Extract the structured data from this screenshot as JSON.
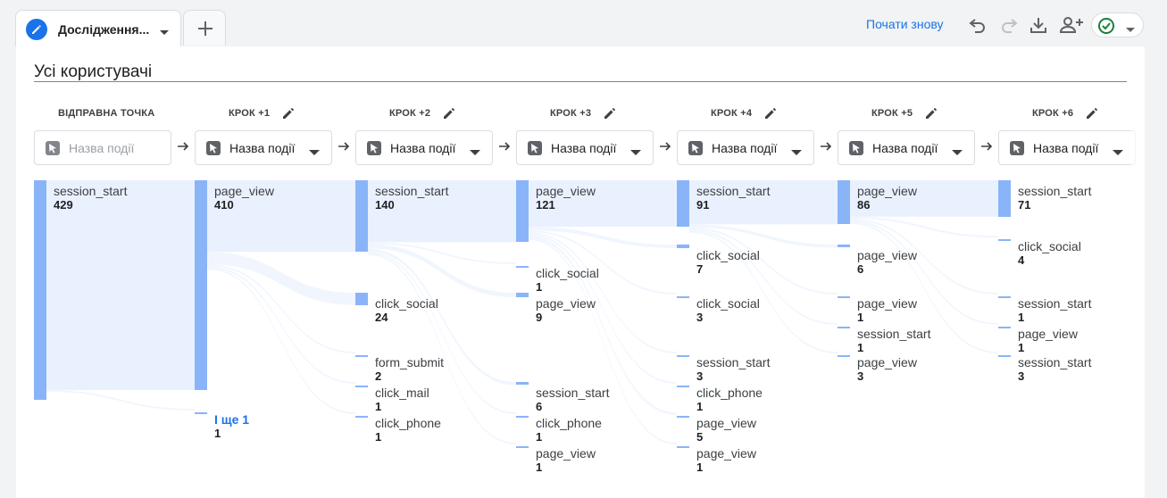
{
  "tab": {
    "title": "Дослідження..."
  },
  "toolbar": {
    "restart_label": "Почати знову"
  },
  "segment": {
    "title": "Усі користувачі"
  },
  "steps": [
    {
      "header": "ВІДПРАВНА ТОЧКА",
      "dropdown": "Назва події",
      "editable": false
    },
    {
      "header": "КРОК +1",
      "dropdown": "Назва події",
      "editable": true
    },
    {
      "header": "КРОК +2",
      "dropdown": "Назва події",
      "editable": true
    },
    {
      "header": "КРОК +3",
      "dropdown": "Назва події",
      "editable": true
    },
    {
      "header": "КРОК +4",
      "dropdown": "Назва події",
      "editable": true
    },
    {
      "header": "КРОК +5",
      "dropdown": "Назва події",
      "editable": true
    },
    {
      "header": "КРОК +6",
      "dropdown": "Назва події",
      "editable": true
    }
  ],
  "nodes": [
    [
      {
        "name": "session_start",
        "count": 429
      }
    ],
    [
      {
        "name": "page_view",
        "count": 410
      },
      {
        "name": "І ще 1",
        "count": 1,
        "more": true
      }
    ],
    [
      {
        "name": "session_start",
        "count": 140
      },
      {
        "name": "click_social",
        "count": 24
      },
      {
        "name": "form_submit",
        "count": 2
      },
      {
        "name": "click_mail",
        "count": 1
      },
      {
        "name": "click_phone",
        "count": 1
      }
    ],
    [
      {
        "name": "page_view",
        "count": 121
      },
      {
        "name": "click_social",
        "count": 1
      },
      {
        "name": "page_view",
        "count": 9
      },
      {
        "name": "session_start",
        "count": 6
      },
      {
        "name": "click_phone",
        "count": 1
      },
      {
        "name": "page_view",
        "count": 1
      }
    ],
    [
      {
        "name": "session_start",
        "count": 91
      },
      {
        "name": "click_social",
        "count": 7
      },
      {
        "name": "click_social",
        "count": 3
      },
      {
        "name": "session_start",
        "count": 3
      },
      {
        "name": "click_phone",
        "count": 1
      },
      {
        "name": "page_view",
        "count": 5
      },
      {
        "name": "page_view",
        "count": 1
      }
    ],
    [
      {
        "name": "page_view",
        "count": 86
      },
      {
        "name": "page_view",
        "count": 6
      },
      {
        "name": "page_view",
        "count": 1
      },
      {
        "name": "session_start",
        "count": 1
      },
      {
        "name": "page_view",
        "count": 3
      }
    ],
    [
      {
        "name": "session_start",
        "count": 71
      },
      {
        "name": "click_social",
        "count": 4
      },
      {
        "name": "session_start",
        "count": 1
      },
      {
        "name": "page_view",
        "count": 1
      },
      {
        "name": "session_start",
        "count": 3
      }
    ]
  ],
  "colors": {
    "accent": "#1a73e8",
    "node": "#8ab4f8",
    "flow": "#e8f0fe",
    "success": "#188038"
  },
  "icons": [
    "pencil-icon",
    "add-icon",
    "undo-icon",
    "redo-icon",
    "download-icon",
    "share-icon",
    "check-circle-icon",
    "cursor-icon",
    "arrow-right-icon",
    "chevron-down-icon"
  ]
}
